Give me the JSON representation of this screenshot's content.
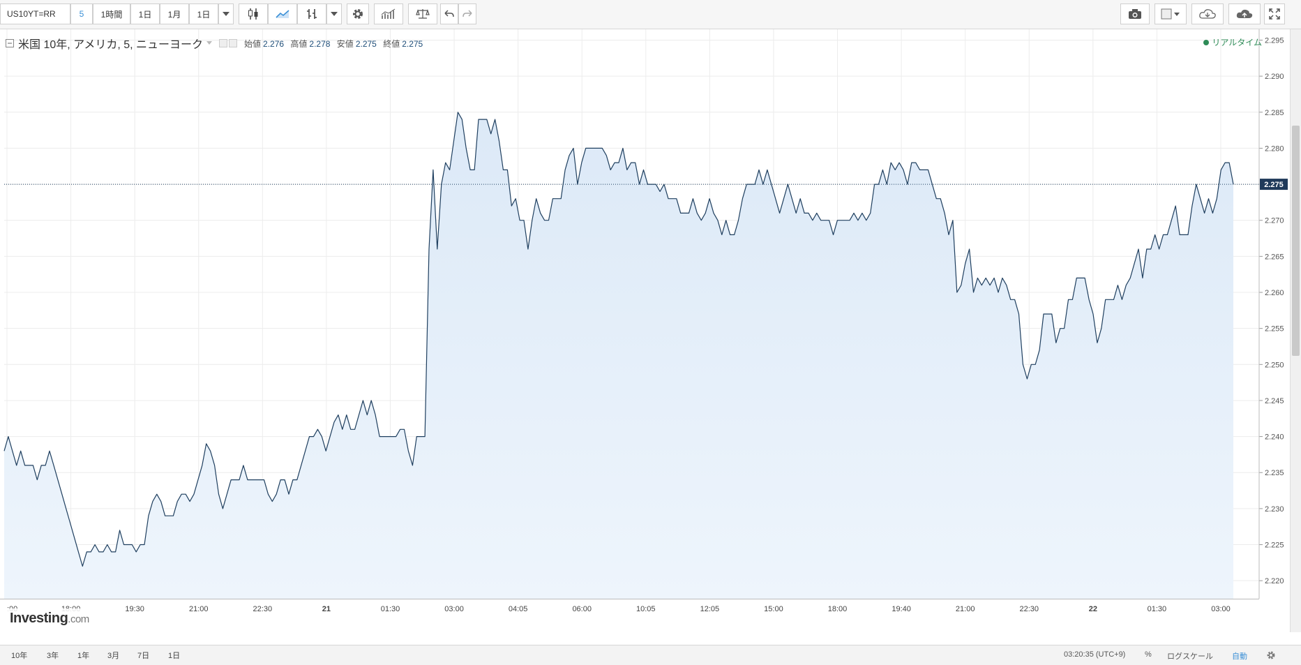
{
  "toolbar": {
    "symbol": "US10YT=RR",
    "interval": "5",
    "buttons": [
      "1時間",
      "1日",
      "1月",
      "1日"
    ]
  },
  "legend": {
    "title": "米国 10年, アメリカ, 5, ニューヨーク",
    "open_label": "始値",
    "open": "2.276",
    "high_label": "高値",
    "high": "2.278",
    "low_label": "安値",
    "low": "2.275",
    "close_label": "終値",
    "close": "2.275"
  },
  "realtime_label": "リアルタイム",
  "logo": {
    "main": "Investing",
    "suffix": ".com"
  },
  "bottombar": {
    "ranges": [
      "10年",
      "3年",
      "1年",
      "3月",
      "7日",
      "1日"
    ],
    "clock": "03:20:35 (UTC+9)",
    "percent": "%",
    "log_scale": "ログスケール",
    "auto": "自動"
  },
  "colors": {
    "line": "#1f3f5f",
    "fill": "#dce9f7",
    "accent": "#3a8fd6",
    "grid": "#ececec",
    "realtime": "#2e8b57"
  },
  "chart_data": {
    "type": "area",
    "symbol": "US10YT=RR",
    "y_axis_side": "right",
    "ylim": [
      2.2175,
      2.2965
    ],
    "y_ticks": [
      2.22,
      2.225,
      2.23,
      2.235,
      2.24,
      2.245,
      2.25,
      2.255,
      2.26,
      2.265,
      2.27,
      2.275,
      2.28,
      2.285,
      2.29,
      2.295
    ],
    "x_tick_labels": [
      ":00",
      "18:00",
      "19:30",
      "21:00",
      "22:30",
      "21",
      "01:30",
      "03:00",
      "04:05",
      "06:00",
      "10:05",
      "12:05",
      "15:00",
      "18:00",
      "19:40",
      "21:00",
      "22:30",
      "22",
      "01:30",
      "03:00"
    ],
    "x_tick_bold": [
      "21",
      "22"
    ],
    "current_value": "2.275",
    "grid": true,
    "values": [
      2.238,
      2.24,
      2.238,
      2.236,
      2.238,
      2.236,
      2.236,
      2.236,
      2.234,
      2.236,
      2.236,
      2.238,
      2.236,
      2.234,
      2.232,
      2.23,
      2.228,
      2.226,
      2.224,
      2.222,
      2.224,
      2.224,
      2.225,
      2.224,
      2.224,
      2.225,
      2.224,
      2.224,
      2.227,
      2.225,
      2.225,
      2.225,
      2.224,
      2.225,
      2.225,
      2.229,
      2.231,
      2.232,
      2.231,
      2.229,
      2.229,
      2.229,
      2.231,
      2.232,
      2.232,
      2.231,
      2.232,
      2.234,
      2.236,
      2.239,
      2.238,
      2.236,
      2.232,
      2.23,
      2.232,
      2.234,
      2.234,
      2.234,
      2.236,
      2.234,
      2.234,
      2.234,
      2.234,
      2.234,
      2.232,
      2.231,
      2.232,
      2.234,
      2.234,
      2.232,
      2.234,
      2.234,
      2.236,
      2.238,
      2.24,
      2.24,
      2.241,
      2.24,
      2.238,
      2.24,
      2.242,
      2.243,
      2.241,
      2.243,
      2.241,
      2.241,
      2.243,
      2.245,
      2.243,
      2.245,
      2.243,
      2.24,
      2.24,
      2.24,
      2.24,
      2.24,
      2.241,
      2.241,
      2.238,
      2.236,
      2.24,
      2.24,
      2.24,
      2.266,
      2.277,
      2.266,
      2.275,
      2.278,
      2.277,
      2.281,
      2.285,
      2.284,
      2.28,
      2.277,
      2.277,
      2.284,
      2.284,
      2.284,
      2.282,
      2.284,
      2.281,
      2.277,
      2.277,
      2.272,
      2.273,
      2.27,
      2.27,
      2.266,
      2.27,
      2.273,
      2.271,
      2.27,
      2.27,
      2.273,
      2.273,
      2.273,
      2.277,
      2.279,
      2.28,
      2.275,
      2.278,
      2.28,
      2.28,
      2.28,
      2.28,
      2.28,
      2.279,
      2.277,
      2.278,
      2.278,
      2.28,
      2.277,
      2.278,
      2.278,
      2.275,
      2.277,
      2.275,
      2.275,
      2.275,
      2.274,
      2.275,
      2.273,
      2.273,
      2.273,
      2.271,
      2.271,
      2.271,
      2.273,
      2.271,
      2.27,
      2.271,
      2.273,
      2.271,
      2.27,
      2.268,
      2.27,
      2.268,
      2.268,
      2.27,
      2.273,
      2.275,
      2.275,
      2.275,
      2.277,
      2.275,
      2.277,
      2.275,
      2.273,
      2.271,
      2.273,
      2.275,
      2.273,
      2.271,
      2.273,
      2.271,
      2.271,
      2.27,
      2.271,
      2.27,
      2.27,
      2.27,
      2.268,
      2.27,
      2.27,
      2.27,
      2.27,
      2.271,
      2.27,
      2.271,
      2.27,
      2.271,
      2.275,
      2.275,
      2.277,
      2.275,
      2.278,
      2.277,
      2.278,
      2.277,
      2.275,
      2.278,
      2.278,
      2.277,
      2.277,
      2.277,
      2.275,
      2.273,
      2.273,
      2.271,
      2.268,
      2.27,
      2.26,
      2.261,
      2.264,
      2.266,
      2.26,
      2.262,
      2.261,
      2.262,
      2.261,
      2.262,
      2.26,
      2.262,
      2.261,
      2.259,
      2.259,
      2.257,
      2.25,
      2.248,
      2.25,
      2.25,
      2.252,
      2.257,
      2.257,
      2.257,
      2.253,
      2.255,
      2.255,
      2.259,
      2.259,
      2.262,
      2.262,
      2.262,
      2.259,
      2.257,
      2.253,
      2.255,
      2.259,
      2.259,
      2.259,
      2.261,
      2.259,
      2.261,
      2.262,
      2.264,
      2.266,
      2.262,
      2.266,
      2.266,
      2.268,
      2.266,
      2.268,
      2.268,
      2.27,
      2.272,
      2.268,
      2.268,
      2.268,
      2.272,
      2.275,
      2.273,
      2.271,
      2.273,
      2.271,
      2.273,
      2.277,
      2.278,
      2.278,
      2.275
    ]
  }
}
